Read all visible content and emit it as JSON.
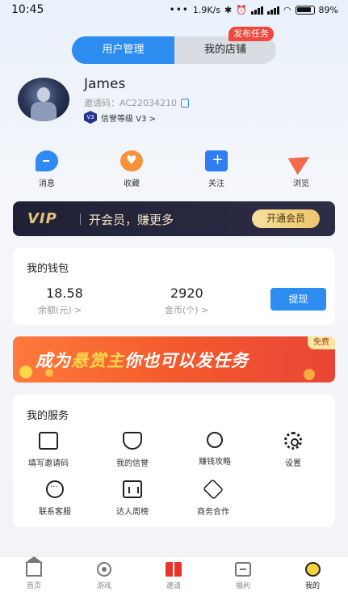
{
  "status_bar": {
    "time": "10:45",
    "net_speed": "1.9K/s",
    "battery": "89%"
  },
  "tabs": [
    {
      "label": "用户管理",
      "active": true
    },
    {
      "label": "我的店铺",
      "active": false
    }
  ],
  "publish_badge": "发布任务",
  "profile": {
    "name": "James",
    "invite_code": "邀请码：AC22034210",
    "level_badge": "V3",
    "level_text": "信誉等级 V3 >"
  },
  "quick_actions": [
    {
      "label": "消息",
      "icon": "message-icon"
    },
    {
      "label": "收藏",
      "icon": "favorite-icon"
    },
    {
      "label": "关注",
      "icon": "follow-icon"
    },
    {
      "label": "浏览",
      "icon": "browse-icon"
    }
  ],
  "vip": {
    "logo": "VIP",
    "text": "开会员，赚更多",
    "button": "开通会员"
  },
  "wallet": {
    "title": "我的钱包",
    "balance_value": "18.58",
    "balance_label": "余额(元) >",
    "coins_value": "2920",
    "coins_label": "金币(个) >",
    "withdraw_button": "提现"
  },
  "promo": {
    "text_prefix": "成为",
    "text_highlight": "悬赏主",
    "text_suffix": "你也可以发任务",
    "badge": "免费"
  },
  "services": {
    "title": "我的服务",
    "items": [
      {
        "label": "填写邀请码",
        "icon": "invite-code-icon"
      },
      {
        "label": "我的信誉",
        "icon": "reputation-icon"
      },
      {
        "label": "赚钱攻略",
        "icon": "tips-icon"
      },
      {
        "label": "设置",
        "icon": "settings-icon"
      },
      {
        "label": "联系客服",
        "icon": "customer-service-icon"
      },
      {
        "label": "达人周榜",
        "icon": "ranking-icon"
      },
      {
        "label": "商务合作",
        "icon": "cooperation-icon"
      }
    ]
  },
  "bottom_nav": [
    {
      "label": "首页",
      "icon": "home-icon",
      "active": false
    },
    {
      "label": "游戏",
      "icon": "game-icon",
      "active": false
    },
    {
      "label": "邀请",
      "icon": "gift-icon",
      "active": false
    },
    {
      "label": "福利",
      "icon": "welfare-icon",
      "active": false
    },
    {
      "label": "我的",
      "icon": "mine-icon",
      "active": true
    }
  ],
  "colors": {
    "primary": "#2d8cf0",
    "badge_red": "#f0483f",
    "vip_gold": "#e4c27a",
    "promo_orange": "#f35a2c"
  }
}
